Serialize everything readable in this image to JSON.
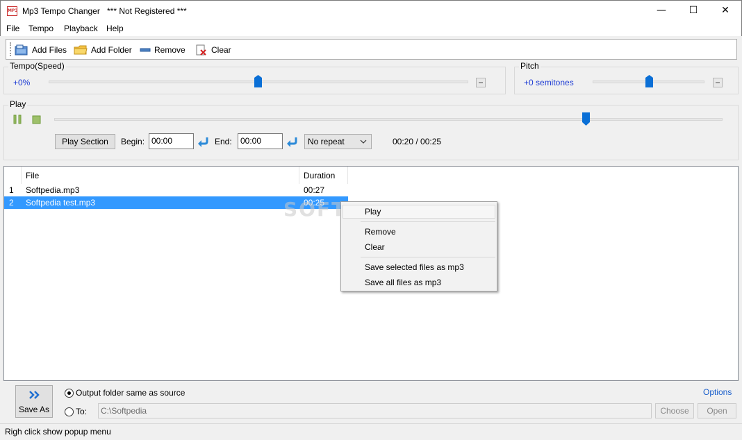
{
  "window": {
    "title": "Mp3 Tempo Changer",
    "registration": "*** Not Registered ***",
    "icon_text": "MP3",
    "minimize": "—",
    "maximize": "☐",
    "close": "✕"
  },
  "menu": [
    "File",
    "Tempo",
    "Playback",
    "Help"
  ],
  "toolbar": {
    "add_files": "Add Files",
    "add_folder": "Add Folder",
    "remove": "Remove",
    "clear": "Clear"
  },
  "tempo": {
    "title": "Tempo(Speed)",
    "value": "+0%",
    "slider_level": 0.5
  },
  "pitch": {
    "title": "Pitch",
    "value": "+0 semitones",
    "slider_level": 0.5
  },
  "play": {
    "title": "Play",
    "position_level": 0.8,
    "play_section": "Play Section",
    "begin_label": "Begin:",
    "begin_value": "00:00",
    "end_label": "End:",
    "end_value": "00:00",
    "repeat": "No repeat",
    "time": "00:20 / 00:25"
  },
  "filelist": {
    "columns": [
      "File",
      "Duration"
    ],
    "rows": [
      {
        "index": "1",
        "file": "Softpedia.mp3",
        "duration": "00:27",
        "selected": false
      },
      {
        "index": "2",
        "file": "Softpedia test.mp3",
        "duration": "00:25",
        "selected": true
      }
    ],
    "watermark": "SOFTPEDIA"
  },
  "context_menu": {
    "play": "Play",
    "remove": "Remove",
    "clear": "Clear",
    "save_selected": "Save selected files as mp3",
    "save_all": "Save all files as mp3"
  },
  "output": {
    "save_as": "Save As",
    "same_as_source": "Output folder same as source",
    "to_label": "To:",
    "path": "C:\\Softpedia",
    "options": "Options",
    "choose": "Choose",
    "open": "Open"
  },
  "status": "Righ click show popup menu",
  "colors": {
    "accent": "#3399ff",
    "value_blue": "#1c3bd4",
    "slider_thumb": "#0a6fd6"
  }
}
